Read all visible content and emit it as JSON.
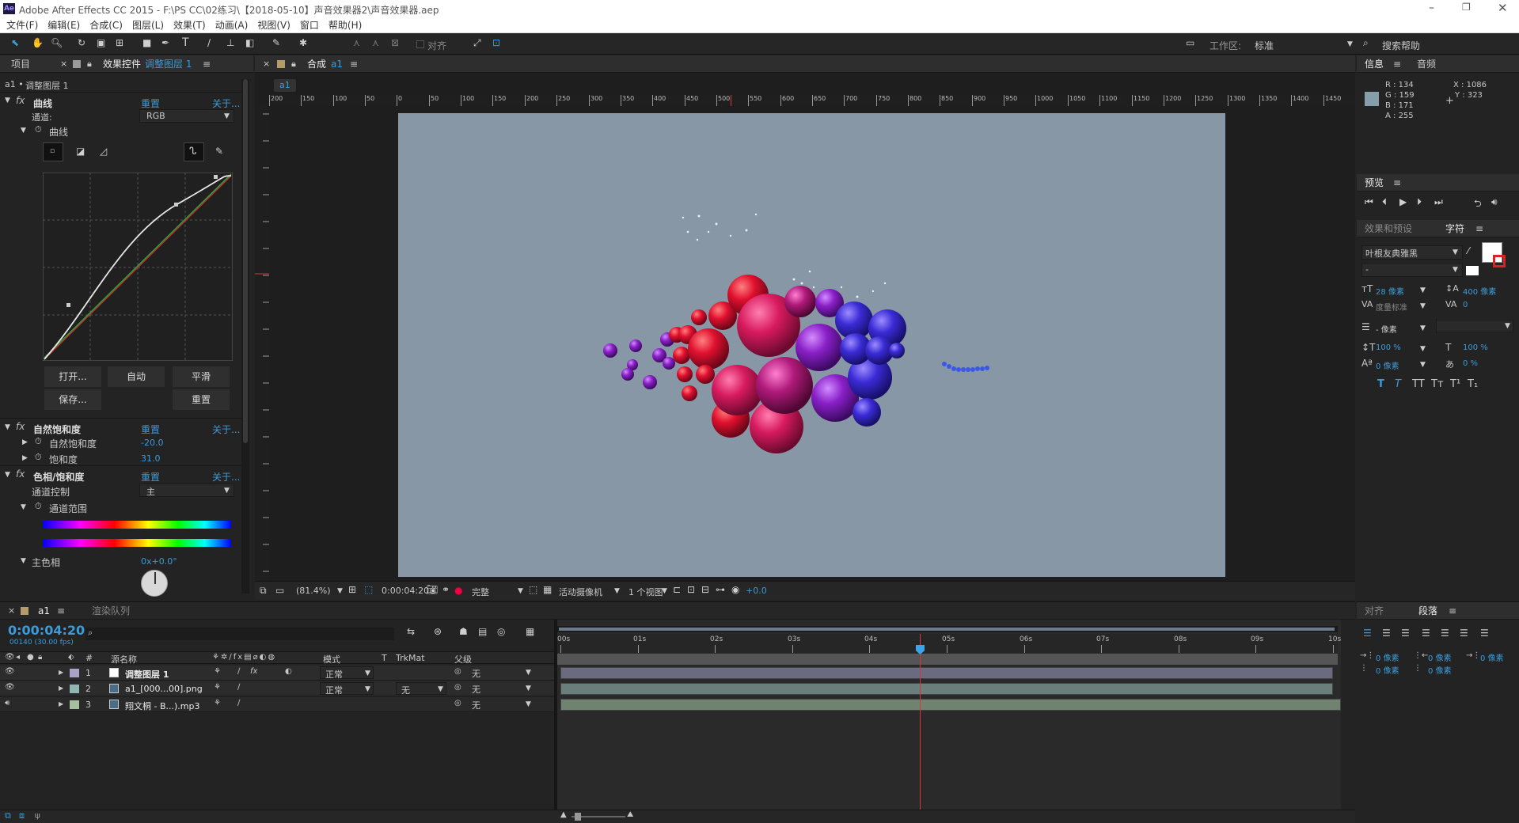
{
  "app": {
    "title": "Adobe After Effects CC 2015 - F:\\PS CC\\02练习\\【2018-05-10】声音效果器2\\声音效果器.aep"
  },
  "menu": [
    "文件(F)",
    "编辑(E)",
    "合成(C)",
    "图层(L)",
    "效果(T)",
    "动画(A)",
    "视图(V)",
    "窗口",
    "帮助(H)"
  ],
  "toolbar": {
    "align_label": "对齐",
    "workspace_label": "工作区:",
    "workspace_value": "标准",
    "search_help": "搜索帮助"
  },
  "left_panel": {
    "tabs": {
      "project": "项目",
      "effects": "效果控件",
      "effects_layer": "调整图层 1"
    },
    "breadcrumb_a": "a1 •",
    "breadcrumb_b": "调整图层 1",
    "curves": {
      "name": "曲线",
      "reset": "重置",
      "about": "关于...",
      "channel_label": "通道:",
      "channel_value": "RGB",
      "curve_sub": "曲线",
      "open": "打开...",
      "auto": "自动",
      "smooth": "平滑",
      "save": "保存...",
      "reset2": "重置"
    },
    "vibrance": {
      "name": "自然饱和度",
      "reset": "重置",
      "about": "关于...",
      "vib_label": "自然饱和度",
      "vib_value": "-20.0",
      "sat_label": "饱和度",
      "sat_value": "31.0"
    },
    "huesat": {
      "name": "色相/饱和度",
      "reset": "重置",
      "about": "关于...",
      "ctrl_label": "通道控制",
      "ctrl_value": "主",
      "range_label": "通道范围",
      "hue_label": "主色相",
      "hue_value": "0x+0.0°"
    }
  },
  "comp": {
    "tab": "合成",
    "tab_comp": "a1",
    "sub_tab": "a1",
    "ruler_labels": [
      "200",
      "150",
      "100",
      "50",
      "0",
      "50",
      "100",
      "150",
      "200",
      "250",
      "300",
      "350",
      "400",
      "450",
      "500",
      "550",
      "600",
      "650",
      "700",
      "750",
      "800",
      "850",
      "900",
      "950",
      "1000",
      "1050",
      "1100",
      "1150",
      "1200",
      "1250",
      "1300",
      "1350",
      "1400",
      "1450"
    ],
    "footer": {
      "zoom": "(81.4%)",
      "time": "0:00:04:20",
      "quality": "完整",
      "camera": "活动摄像机",
      "views": "1 个视图",
      "exposure": "+0.0"
    },
    "bg_color": "#8797a6"
  },
  "info": {
    "tab": "信息",
    "audio_tab": "音频",
    "r": "R : 134",
    "g": "G : 159",
    "b": "B : 171",
    "a": "A : 255",
    "x": "X : 1086",
    "y": "Y : 323"
  },
  "preview": {
    "tab": "预览"
  },
  "character": {
    "tab_effects": "效果和预设",
    "tab_char": "字符",
    "font": "叶根友典雅黑",
    "style": "-",
    "size": "28 像素",
    "leading": "400 像素",
    "kerning": "度量标准",
    "tracking": "0",
    "stroke": "- 像素",
    "vscale": "100 %",
    "hscale": "100 %",
    "baseline": "0 像素",
    "tsume": "0 %"
  },
  "paragraph": {
    "tab_align": "对齐",
    "tab_para": "段落",
    "indent1": "0 像素",
    "indent2": "0 像素",
    "indent3": "0 像素",
    "indent4": "0 像素",
    "indent5": "0 像素"
  },
  "timeline": {
    "tab": "a1",
    "render_tab": "渲染队列",
    "timecode": "0:00:04:20",
    "frameinfo": "00140 (30.00 fps)",
    "cols": {
      "hash": "#",
      "source": "源名称",
      "mode": "模式",
      "t": "T",
      "trkmat": "TrkMat",
      "parent": "父级"
    },
    "ruler": [
      "00s",
      "01s",
      "02s",
      "03s",
      "04s",
      "05s",
      "06s",
      "07s",
      "08s",
      "09s",
      "10s"
    ],
    "layers": [
      {
        "num": "1",
        "name": "调整图层 1",
        "mode": "正常",
        "trkmat": "",
        "parent": "无",
        "color": "#a9a3c7",
        "bar": "#6b6b80"
      },
      {
        "num": "2",
        "name": "a1_[000...00].png",
        "mode": "正常",
        "trkmat": "无",
        "parent": "无",
        "color": "#8fb6b0",
        "bar": "#6a7f7b"
      },
      {
        "num": "3",
        "name": "翔文桐 - B...).mp3",
        "mode": "",
        "trkmat": "",
        "parent": "无",
        "color": "#a6c09e",
        "bar": "#6f8370"
      }
    ]
  }
}
